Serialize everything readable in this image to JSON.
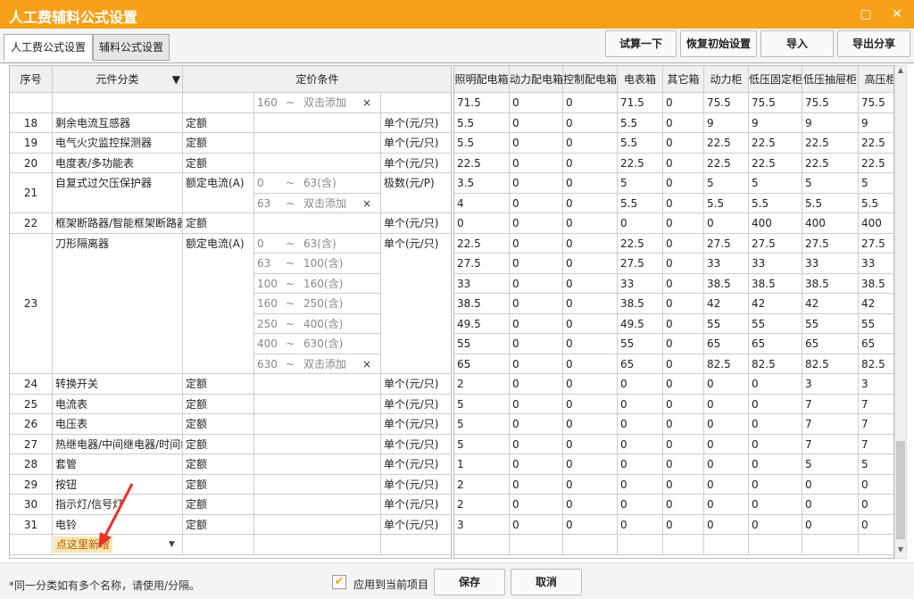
{
  "window": {
    "title": "人工费辅料公式设置"
  },
  "tabs": [
    {
      "label": "人工费公式设置"
    },
    {
      "label": "辅料公式设置"
    }
  ],
  "toolbar": {
    "trial": "试算一下",
    "restore": "恢复初始设置",
    "import": "导入",
    "export": "导出分享"
  },
  "left_headers": {
    "seq": "序号",
    "category": "元件分类",
    "pricing": "定价条件"
  },
  "right_headers": [
    "照明配电箱",
    "动力配电箱",
    "控制配电箱",
    "电表箱",
    "其它箱",
    "动力柜",
    "低压固定柜",
    "低压抽屉柜",
    "高压柜"
  ],
  "rows": [
    {
      "seq": "",
      "name": "",
      "type": "",
      "unit": "",
      "ranges": [
        [
          "160",
          "~",
          "双击添加"
        ]
      ],
      "values": [
        [
          "71.5",
          "0",
          "0",
          "71.5",
          "0",
          "75.5",
          "75.5",
          "75.5",
          "75.5"
        ]
      ]
    },
    {
      "seq": "18",
      "name": "剩余电流互感器",
      "type": "定额",
      "unit": "单个(元/只)",
      "ranges": [],
      "values": [
        [
          "5.5",
          "0",
          "0",
          "5.5",
          "0",
          "9",
          "9",
          "9",
          "9"
        ]
      ]
    },
    {
      "seq": "19",
      "name": "电气火灾监控探测器",
      "type": "定额",
      "unit": "单个(元/只)",
      "ranges": [],
      "values": [
        [
          "5.5",
          "0",
          "0",
          "5.5",
          "0",
          "22.5",
          "22.5",
          "22.5",
          "22.5"
        ]
      ]
    },
    {
      "seq": "20",
      "name": "电度表/多功能表",
      "type": "定额",
      "unit": "单个(元/只)",
      "ranges": [],
      "values": [
        [
          "22.5",
          "0",
          "0",
          "22.5",
          "0",
          "22.5",
          "22.5",
          "22.5",
          "22.5"
        ]
      ]
    },
    {
      "seq": "21",
      "name": "自复式过欠压保护器",
      "type": "额定电流(A)",
      "unit": "极数(元/P)",
      "ranges": [
        [
          "0",
          "~",
          "63(含)"
        ],
        [
          "63",
          "~",
          "双击添加"
        ]
      ],
      "values": [
        [
          "3.5",
          "0",
          "0",
          "5",
          "0",
          "5",
          "5",
          "5",
          "5"
        ],
        [
          "4",
          "0",
          "0",
          "5.5",
          "0",
          "5.5",
          "5.5",
          "5.5",
          "5.5"
        ]
      ]
    },
    {
      "seq": "22",
      "name": "框架断路器/智能框架断路器",
      "type": "定额",
      "unit": "单个(元/只)",
      "ranges": [],
      "values": [
        [
          "0",
          "0",
          "0",
          "0",
          "0",
          "0",
          "400",
          "400",
          "400"
        ]
      ]
    },
    {
      "seq": "23",
      "name": "刀形隔离器",
      "type": "额定电流(A)",
      "unit": "单个(元/只)",
      "ranges": [
        [
          "0",
          "~",
          "63(含)"
        ],
        [
          "63",
          "~",
          "100(含)"
        ],
        [
          "100",
          "~",
          "160(含)"
        ],
        [
          "160",
          "~",
          "250(含)"
        ],
        [
          "250",
          "~",
          "400(含)"
        ],
        [
          "400",
          "~",
          "630(含)"
        ],
        [
          "630",
          "~",
          "双击添加"
        ]
      ],
      "values": [
        [
          "22.5",
          "0",
          "0",
          "22.5",
          "0",
          "27.5",
          "27.5",
          "27.5",
          "27.5"
        ],
        [
          "27.5",
          "0",
          "0",
          "27.5",
          "0",
          "33",
          "33",
          "33",
          "33"
        ],
        [
          "33",
          "0",
          "0",
          "33",
          "0",
          "38.5",
          "38.5",
          "38.5",
          "38.5"
        ],
        [
          "38.5",
          "0",
          "0",
          "38.5",
          "0",
          "42",
          "42",
          "42",
          "42"
        ],
        [
          "49.5",
          "0",
          "0",
          "49.5",
          "0",
          "55",
          "55",
          "55",
          "55"
        ],
        [
          "55",
          "0",
          "0",
          "55",
          "0",
          "65",
          "65",
          "65",
          "65"
        ],
        [
          "65",
          "0",
          "0",
          "65",
          "0",
          "82.5",
          "82.5",
          "82.5",
          "82.5"
        ]
      ]
    },
    {
      "seq": "24",
      "name": "转换开关",
      "type": "定额",
      "unit": "单个(元/只)",
      "ranges": [],
      "values": [
        [
          "2",
          "0",
          "0",
          "0",
          "0",
          "0",
          "0",
          "3",
          "3"
        ]
      ]
    },
    {
      "seq": "25",
      "name": "电流表",
      "type": "定额",
      "unit": "单个(元/只)",
      "ranges": [],
      "values": [
        [
          "5",
          "0",
          "0",
          "0",
          "0",
          "0",
          "0",
          "7",
          "7"
        ]
      ]
    },
    {
      "seq": "26",
      "name": "电压表",
      "type": "定额",
      "unit": "单个(元/只)",
      "ranges": [],
      "values": [
        [
          "5",
          "0",
          "0",
          "0",
          "0",
          "0",
          "0",
          "7",
          "7"
        ]
      ]
    },
    {
      "seq": "27",
      "name": "热继电器/中间继电器/时间继电器",
      "type": "定额",
      "unit": "单个(元/只)",
      "ranges": [],
      "values": [
        [
          "5",
          "0",
          "0",
          "0",
          "0",
          "0",
          "0",
          "7",
          "7"
        ]
      ]
    },
    {
      "seq": "28",
      "name": "套管",
      "type": "定额",
      "unit": "单个(元/只)",
      "ranges": [],
      "values": [
        [
          "1",
          "0",
          "0",
          "0",
          "0",
          "0",
          "0",
          "5",
          "5"
        ]
      ]
    },
    {
      "seq": "29",
      "name": "按钮",
      "type": "定额",
      "unit": "单个(元/只)",
      "ranges": [],
      "values": [
        [
          "2",
          "0",
          "0",
          "0",
          "0",
          "0",
          "0",
          "0",
          "0"
        ]
      ]
    },
    {
      "seq": "30",
      "name": "指示灯/信号灯",
      "type": "定额",
      "unit": "单个(元/只)",
      "ranges": [],
      "values": [
        [
          "2",
          "0",
          "0",
          "0",
          "0",
          "0",
          "0",
          "0",
          "0"
        ]
      ]
    },
    {
      "seq": "31",
      "name": "电铃",
      "type": "定额",
      "unit": "单个(元/只)",
      "ranges": [],
      "values": [
        [
          "3",
          "0",
          "0",
          "0",
          "0",
          "0",
          "0",
          "0",
          "0"
        ]
      ]
    }
  ],
  "new_row_label": "点这里新增",
  "range_delete_mark": "×",
  "footer": {
    "hint": "*同一分类如有多个名称，请使用/分隔。",
    "apply_label": "应用到当前项目",
    "save": "保存",
    "cancel": "取消"
  },
  "colors": {
    "accent": "#f7a11a"
  }
}
